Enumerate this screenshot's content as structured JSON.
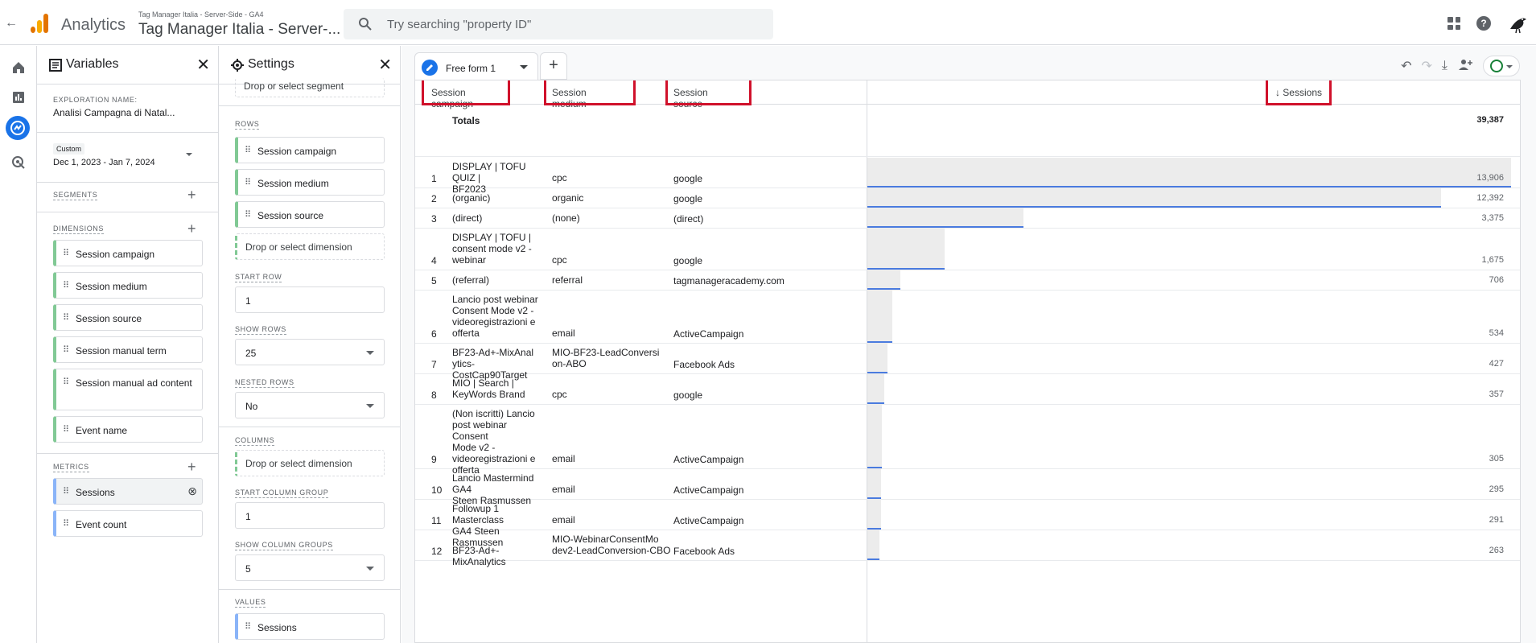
{
  "topbar": {
    "app_name": "Analytics",
    "account_small": "Tag Manager Italia - Server-Side - GA4",
    "account_big": "Tag Manager Italia - Server-...",
    "search_placeholder": "Try searching \"property ID\""
  },
  "variables": {
    "title": "Variables",
    "exploration_label": "EXPLORATION NAME:",
    "exploration_name": "Analisi Campagna di Natal...",
    "date_label": "Custom",
    "date_range": "Dec 1, 2023 - Jan 7, 2024",
    "segments_label": "SEGMENTS",
    "dimensions_label": "DIMENSIONS",
    "dimensions": [
      "Session campaign",
      "Session medium",
      "Session source",
      "Session manual term",
      "Session manual ad content",
      "Event name"
    ],
    "metrics_label": "METRICS",
    "metrics": [
      "Sessions",
      "Event count"
    ]
  },
  "settings": {
    "title": "Settings",
    "drop_segment": "Drop or select segment",
    "rows_label": "ROWS",
    "rows": [
      "Session campaign",
      "Session medium",
      "Session source"
    ],
    "drop_dimension": "Drop or select dimension",
    "start_row_label": "START ROW",
    "start_row": "1",
    "show_rows_label": "SHOW ROWS",
    "show_rows": "25",
    "nested_rows_label": "NESTED ROWS",
    "nested_rows": "No",
    "columns_label": "COLUMNS",
    "drop_dimension_cols": "Drop or select dimension",
    "start_col_label": "START COLUMN GROUP",
    "start_col": "1",
    "show_col_label": "SHOW COLUMN GROUPS",
    "show_col": "5",
    "values_label": "VALUES",
    "values": [
      "Sessions"
    ]
  },
  "canvas": {
    "tab_name": "Free form 1",
    "headers": {
      "campaign": "Session campaign",
      "medium": "Session medium",
      "source": "Session source",
      "metric": "↓ Sessions"
    },
    "totals_label": "Totals",
    "totals_value": "39,387",
    "highlight_color": "#d0112b",
    "bar_color": "#4a7bdf",
    "rows": [
      {
        "n": "1",
        "campaign": [
          "DISPLAY | TOFU QUIZ |",
          "BF2023"
        ],
        "medium": "cpc",
        "source": "google",
        "value": "13,906",
        "sessions": 13906
      },
      {
        "n": "2",
        "campaign": [
          "(organic)"
        ],
        "medium": "organic",
        "source": "google",
        "value": "12,392",
        "sessions": 12392
      },
      {
        "n": "3",
        "campaign": [
          "(direct)"
        ],
        "medium": "(none)",
        "source": "(direct)",
        "value": "3,375",
        "sessions": 3375
      },
      {
        "n": "4",
        "campaign": [
          "DISPLAY | TOFU |",
          "consent mode v2 -",
          "webinar"
        ],
        "medium": "cpc",
        "source": "google",
        "value": "1,675",
        "sessions": 1675
      },
      {
        "n": "5",
        "campaign": [
          "(referral)"
        ],
        "medium": "referral",
        "source": "tagmanageracademy.com",
        "value": "706",
        "sessions": 706
      },
      {
        "n": "6",
        "campaign": [
          "Lancio post webinar",
          "Consent Mode v2 -",
          "videoregistrazioni e",
          "offerta"
        ],
        "medium": "email",
        "source": "ActiveCampaign",
        "value": "534",
        "sessions": 534
      },
      {
        "n": "7",
        "campaign": [
          "BF23-Ad+-MixAnal",
          "ytics-CostCap90Target"
        ],
        "medium": "MIO-BF23-LeadConversi\non-ABO",
        "source": "Facebook Ads",
        "value": "427",
        "sessions": 427
      },
      {
        "n": "8",
        "campaign": [
          "MIO | Search |",
          "KeyWords Brand"
        ],
        "medium": "cpc",
        "source": "google",
        "value": "357",
        "sessions": 357
      },
      {
        "n": "9",
        "campaign": [
          "(Non iscritti) Lancio",
          "post webinar Consent",
          "Mode v2 -",
          "videoregistrazioni e",
          "offerta"
        ],
        "medium": "email",
        "source": "ActiveCampaign",
        "value": "305",
        "sessions": 305
      },
      {
        "n": "10",
        "campaign": [
          "Lancio Mastermind GA4",
          "Steen Rasmussen"
        ],
        "medium": "email",
        "source": "ActiveCampaign",
        "value": "295",
        "sessions": 295
      },
      {
        "n": "11",
        "campaign": [
          "Followup 1 Masterclass",
          "GA4 Steen Rasmussen"
        ],
        "medium": "email",
        "source": "ActiveCampaign",
        "value": "291",
        "sessions": 291
      },
      {
        "n": "12",
        "campaign": [
          "BF23-Ad+-MixAnalytics"
        ],
        "medium": "MIO-WebinarConsentMo\ndev2-LeadConversion-CBO",
        "source": "Facebook Ads",
        "value": "263",
        "sessions": 263
      }
    ]
  }
}
